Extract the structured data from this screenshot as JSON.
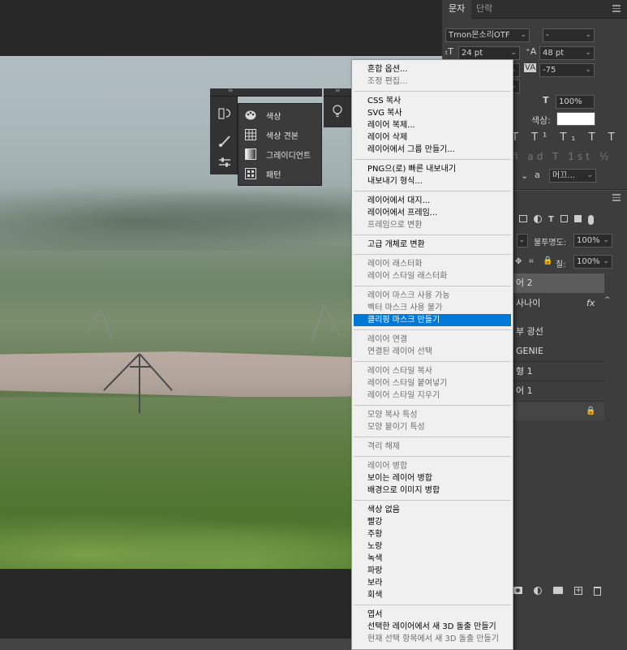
{
  "char_panel": {
    "tabs": [
      "문자",
      "단락"
    ],
    "font_family": "Tmon몬소리OTF",
    "font_style": "-",
    "font_size": "24 pt",
    "leading": "48 pt",
    "tracking": "-75",
    "scale_v": "100%",
    "color_label": "색상:",
    "typo_buttons": [
      "T",
      "T",
      "T",
      "T",
      "T"
    ],
    "lang": "a",
    "aa": "a",
    "aa_value": "머끄..."
  },
  "layers_panel": {
    "opacity_label": "불투명도:",
    "opacity_value": "100%",
    "fill_label": "칠:",
    "fill_value": "100%",
    "layers": [
      {
        "name": "어 2",
        "selected": true
      },
      {
        "name": "사나이",
        "fx": "fx"
      },
      {
        "name": "부 광선"
      },
      {
        "name": "GENIE"
      },
      {
        "name": "형 1"
      },
      {
        "name": "어 1"
      }
    ]
  },
  "color_flyout": {
    "items": [
      {
        "label": "색상",
        "icon": "palette-icon"
      },
      {
        "label": "색상 견본",
        "icon": "swatches-icon"
      },
      {
        "label": "그레이디언트",
        "icon": "gradient-icon"
      },
      {
        "label": "패턴",
        "icon": "pattern-icon"
      }
    ]
  },
  "context_menu": {
    "groups": [
      [
        {
          "label": "혼합 옵션...",
          "disabled": false
        },
        {
          "label": "조정 편집...",
          "disabled": true
        }
      ],
      [
        {
          "label": "CSS 복사",
          "disabled": false
        },
        {
          "label": "SVG 복사",
          "disabled": false
        },
        {
          "label": "레이어 복제...",
          "disabled": false
        },
        {
          "label": "레이어 삭제",
          "disabled": false
        },
        {
          "label": "레이어에서 그룹 만들기...",
          "disabled": false
        }
      ],
      [
        {
          "label": "PNG으(로) 빠른 내보내기",
          "disabled": false
        },
        {
          "label": "내보내기 형식...",
          "disabled": false
        }
      ],
      [
        {
          "label": "레이어에서 대지...",
          "disabled": false
        },
        {
          "label": "레이어에서 프레임...",
          "disabled": false
        },
        {
          "label": "프레임으로 변환",
          "disabled": true
        }
      ],
      [
        {
          "label": "고급 개체로 변환",
          "disabled": false
        }
      ],
      [
        {
          "label": "레이어 래스터화",
          "disabled": true
        },
        {
          "label": "레이어 스타일 래스터화",
          "disabled": true
        }
      ],
      [
        {
          "label": "레이어 마스크 사용 가능",
          "disabled": true
        },
        {
          "label": "벡터 마스크 사용 불가",
          "disabled": true
        },
        {
          "label": "클리핑 마스크 만들기",
          "disabled": false,
          "highlight": true
        }
      ],
      [
        {
          "label": "레이어 연결",
          "disabled": true
        },
        {
          "label": "연결된 레이어 선택",
          "disabled": true
        }
      ],
      [
        {
          "label": "레이어 스타일 복사",
          "disabled": true
        },
        {
          "label": "레이어 스타일 붙여넣기",
          "disabled": true
        },
        {
          "label": "레이어 스타일 지우기",
          "disabled": true
        }
      ],
      [
        {
          "label": "모양 복사 특성",
          "disabled": true
        },
        {
          "label": "모양 붙이기 특성",
          "disabled": true
        }
      ],
      [
        {
          "label": "격리 해제",
          "disabled": true
        }
      ],
      [
        {
          "label": "레이어 병합",
          "disabled": true
        },
        {
          "label": "보이는 레이어 병합",
          "disabled": false
        },
        {
          "label": "배경으로 이미지 병합",
          "disabled": false
        }
      ],
      [
        {
          "label": "색상 없음",
          "disabled": false
        },
        {
          "label": "빨강",
          "disabled": false
        },
        {
          "label": "주황",
          "disabled": false
        },
        {
          "label": "노랑",
          "disabled": false
        },
        {
          "label": "녹색",
          "disabled": false
        },
        {
          "label": "파랑",
          "disabled": false
        },
        {
          "label": "보라",
          "disabled": false
        },
        {
          "label": "회색",
          "disabled": false
        }
      ],
      [
        {
          "label": "엽서",
          "disabled": false
        },
        {
          "label": "선택한 레이어에서 새 3D 돌출 만들기",
          "disabled": false
        },
        {
          "label": "현재 선택 항목에서 새 3D 돌출 만들기",
          "disabled": true
        }
      ]
    ]
  },
  "colors": {
    "highlight": "#0078d7",
    "menu_bg": "#f0f0f0",
    "panel_bg": "#3d3d3d"
  }
}
